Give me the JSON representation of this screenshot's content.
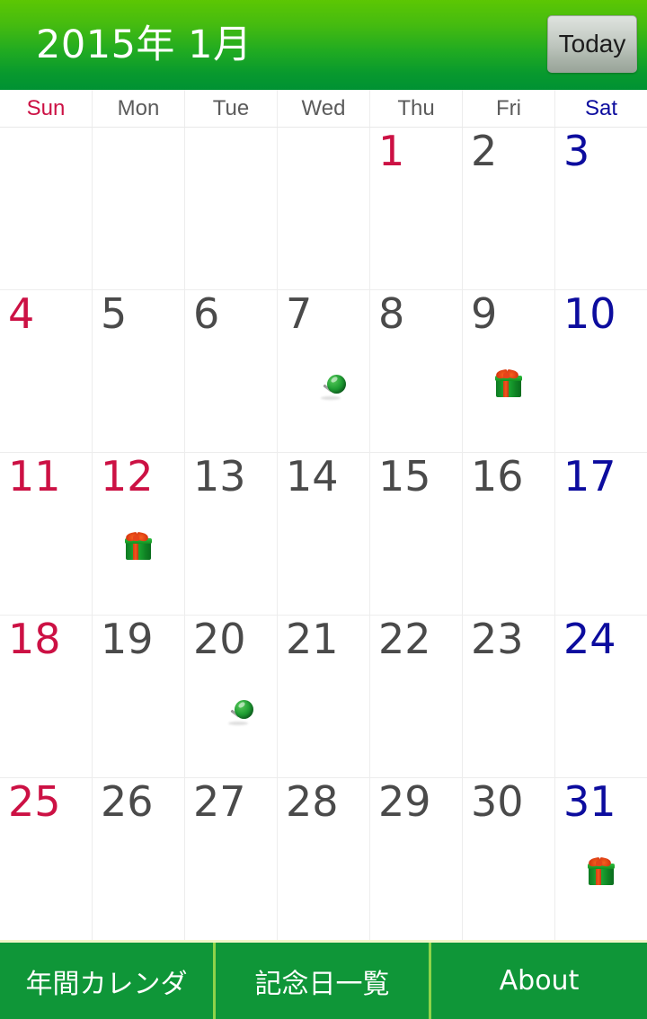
{
  "header": {
    "title": "2015年 1月",
    "today_button_label": "Today",
    "gradient_top": "#5cc703",
    "gradient_bottom": "#009233"
  },
  "weekdays": [
    {
      "label": "Sun",
      "kind": "sun"
    },
    {
      "label": "Mon",
      "kind": "weekday"
    },
    {
      "label": "Tue",
      "kind": "weekday"
    },
    {
      "label": "Wed",
      "kind": "weekday"
    },
    {
      "label": "Thu",
      "kind": "weekday"
    },
    {
      "label": "Fri",
      "kind": "weekday"
    },
    {
      "label": "Sat",
      "kind": "sat"
    }
  ],
  "colors": {
    "sunday_text": "#cc1144",
    "saturday_text": "#0c0c9e",
    "weekday_text": "#4a4a4a",
    "grid_line": "#ededed",
    "nav_background": "#0f9638",
    "nav_divider": "#8fd34a"
  },
  "calendar": {
    "year": "2015",
    "month": "1",
    "weeks": [
      [
        {
          "day": "",
          "kind": "empty"
        },
        {
          "day": "",
          "kind": "empty"
        },
        {
          "day": "",
          "kind": "empty"
        },
        {
          "day": "",
          "kind": "empty"
        },
        {
          "day": "1",
          "kind": "holiday"
        },
        {
          "day": "2",
          "kind": "weekday"
        },
        {
          "day": "3",
          "kind": "sat"
        }
      ],
      [
        {
          "day": "4",
          "kind": "sun"
        },
        {
          "day": "5",
          "kind": "weekday"
        },
        {
          "day": "6",
          "kind": "weekday"
        },
        {
          "day": "7",
          "kind": "weekday",
          "icon": "pushpin-icon"
        },
        {
          "day": "8",
          "kind": "weekday"
        },
        {
          "day": "9",
          "kind": "weekday",
          "icon": "gift-icon"
        },
        {
          "day": "10",
          "kind": "sat"
        }
      ],
      [
        {
          "day": "11",
          "kind": "sun"
        },
        {
          "day": "12",
          "kind": "holiday",
          "icon": "gift-icon"
        },
        {
          "day": "13",
          "kind": "weekday"
        },
        {
          "day": "14",
          "kind": "weekday"
        },
        {
          "day": "15",
          "kind": "weekday"
        },
        {
          "day": "16",
          "kind": "weekday"
        },
        {
          "day": "17",
          "kind": "sat"
        }
      ],
      [
        {
          "day": "18",
          "kind": "sun"
        },
        {
          "day": "19",
          "kind": "weekday"
        },
        {
          "day": "20",
          "kind": "weekday",
          "icon": "pushpin-icon"
        },
        {
          "day": "21",
          "kind": "weekday"
        },
        {
          "day": "22",
          "kind": "weekday"
        },
        {
          "day": "23",
          "kind": "weekday"
        },
        {
          "day": "24",
          "kind": "sat"
        }
      ],
      [
        {
          "day": "25",
          "kind": "sun"
        },
        {
          "day": "26",
          "kind": "weekday"
        },
        {
          "day": "27",
          "kind": "weekday"
        },
        {
          "day": "28",
          "kind": "weekday"
        },
        {
          "day": "29",
          "kind": "weekday"
        },
        {
          "day": "30",
          "kind": "weekday"
        },
        {
          "day": "31",
          "kind": "sat",
          "icon": "gift-icon"
        }
      ]
    ]
  },
  "bottom_nav": [
    {
      "label": "年間カレンダ"
    },
    {
      "label": "記念日一覧"
    },
    {
      "label": "About"
    }
  ]
}
